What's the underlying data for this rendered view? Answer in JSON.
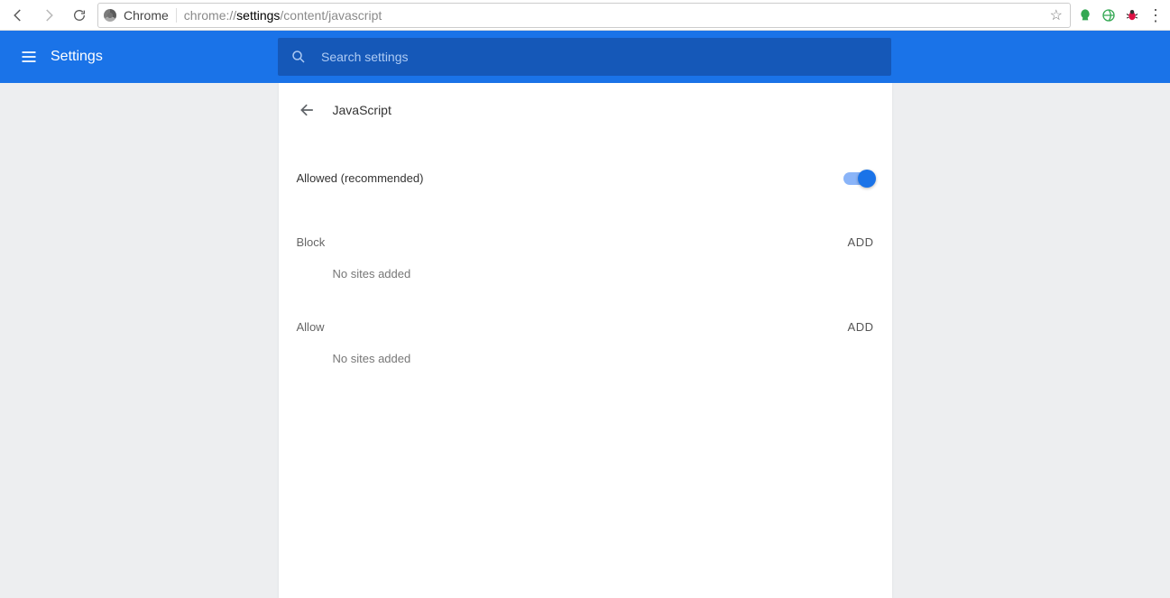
{
  "toolbar": {
    "chrome_label": "Chrome",
    "url_prefix": "chrome://",
    "url_bold": "settings",
    "url_suffix": "/content/javascript"
  },
  "header": {
    "title": "Settings",
    "search_placeholder": "Search settings"
  },
  "page": {
    "section_title": "JavaScript",
    "allowed_label": "Allowed (recommended)",
    "block": {
      "heading": "Block",
      "add_label": "ADD",
      "empty": "No sites added"
    },
    "allow": {
      "heading": "Allow",
      "add_label": "ADD",
      "empty": "No sites added"
    }
  }
}
